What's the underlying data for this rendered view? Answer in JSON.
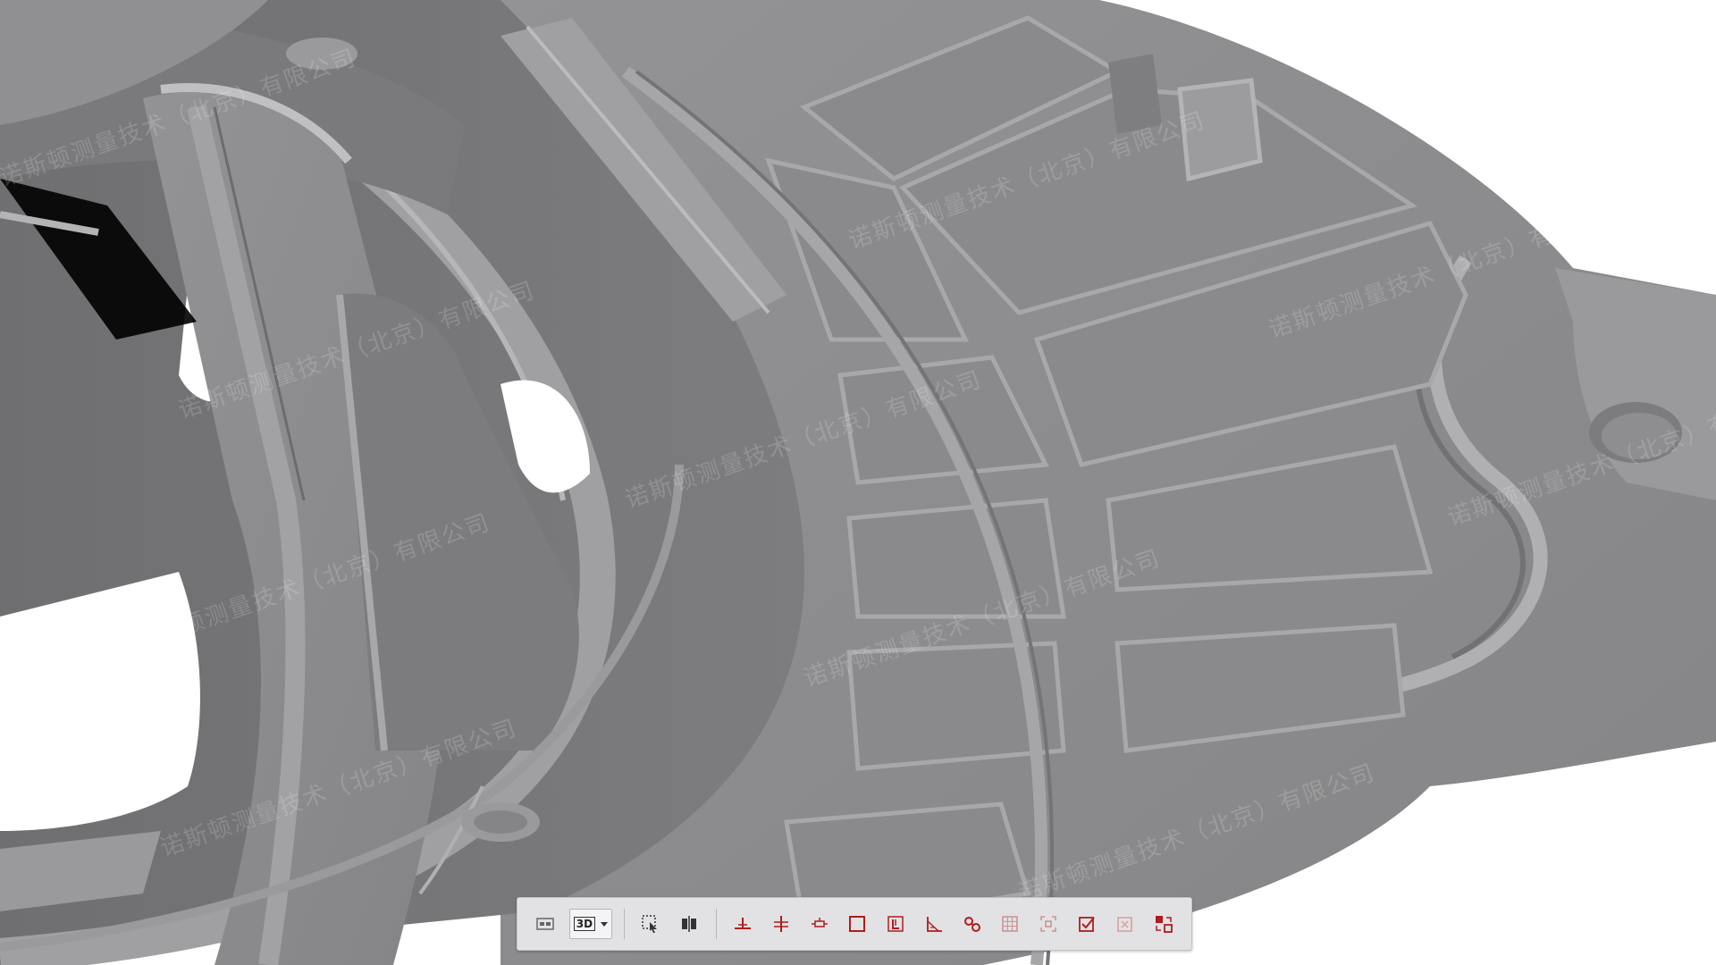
{
  "viewport": {
    "background": "#ffffff",
    "model_color": "#8c8c8e",
    "watermark_text": "诺斯顿测量技术（北京）有限公司"
  },
  "toolbar": {
    "view_mode_label": "3D",
    "buttons": [
      {
        "name": "layout-toggle",
        "icon": "window-layout-icon",
        "color": "#666666"
      },
      {
        "name": "select-box",
        "icon": "select-cursor-icon",
        "color": "#333333"
      },
      {
        "name": "split-view",
        "icon": "split-icon",
        "color": "#333333"
      },
      {
        "name": "plane-align",
        "icon": "align-plane-icon",
        "color": "#b01c1c"
      },
      {
        "name": "cross-section",
        "icon": "section-icon",
        "color": "#b01c1c"
      },
      {
        "name": "dimension",
        "icon": "dimension-icon",
        "color": "#b01c1c"
      },
      {
        "name": "rectangle",
        "icon": "rectangle-icon",
        "color": "#b01c1c"
      },
      {
        "name": "bracket-frame",
        "icon": "frame-icon",
        "color": "#b01c1c"
      },
      {
        "name": "angle-measure",
        "icon": "angle-icon",
        "color": "#b01c1c"
      },
      {
        "name": "link-features",
        "icon": "link-icon",
        "color": "#b01c1c"
      },
      {
        "name": "grid-select",
        "icon": "grid-icon",
        "color": "#c89090"
      },
      {
        "name": "fit-view",
        "icon": "fit-icon",
        "color": "#c89090"
      },
      {
        "name": "check-confirm",
        "icon": "check-icon",
        "color": "#b01c1c"
      },
      {
        "name": "delete-cancel",
        "icon": "delete-icon",
        "color": "#d8a8a8"
      },
      {
        "name": "transform",
        "icon": "transform-icon",
        "color": "#b01c1c"
      }
    ]
  }
}
